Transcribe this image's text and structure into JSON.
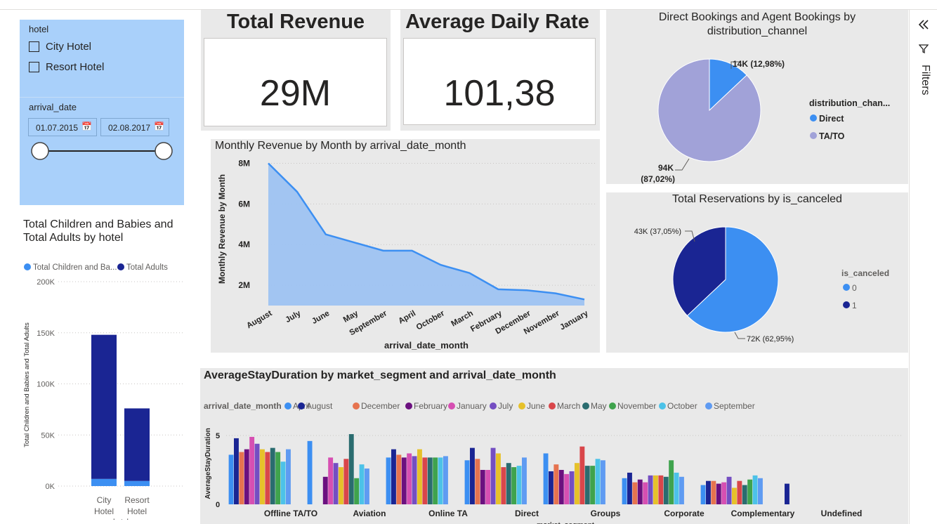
{
  "filters_pane": {
    "label": "Filters",
    "collapse_icon": "double-chevron-left-icon",
    "filter_icon": "funnel-icon"
  },
  "hotel_slicer": {
    "title": "hotel",
    "options": [
      "City Hotel",
      "Resort Hotel"
    ]
  },
  "date_slicer": {
    "title": "arrival_date",
    "start": "01.07.2015",
    "end": "02.08.2017"
  },
  "kpis": [
    {
      "title": "Total Revenue",
      "value": "29M"
    },
    {
      "title": "Average Daily Rate",
      "value": "101,38"
    }
  ],
  "colors": {
    "panel_bg": "#e9e9e9",
    "slicer_bg": "#a9d0fa",
    "light_blue": "#3c8ff2",
    "dark_blue": "#1a2593",
    "lavender": "#a1a2d8"
  },
  "chart_data": [
    {
      "id": "children_adults",
      "type": "bar",
      "stacked": true,
      "title": "Total Children and Babies and Total Adults by hotel",
      "xlabel": "hotel",
      "ylabel": "Total Children and Babies and Total Adults",
      "legend": [
        "Total Children and Ba...",
        "Total Adults"
      ],
      "ytick_labels": [
        "0K",
        "50K",
        "100K",
        "150K",
        "200K"
      ],
      "categories": [
        "City Hotel",
        "Resort Hotel"
      ],
      "category_lines": [
        [
          "City",
          "Hotel"
        ],
        [
          "Resort",
          "Hotel"
        ]
      ],
      "series": [
        {
          "name": "Total Children and Babies",
          "color": "#3c8ff2",
          "values": [
            7000,
            5000
          ]
        },
        {
          "name": "Total Adults",
          "color": "#1a2593",
          "values": [
            141000,
            71000
          ]
        }
      ],
      "ylim": [
        0,
        200000
      ]
    },
    {
      "id": "monthly_revenue",
      "type": "area",
      "title": "Monthly Revenue by Month by arrival_date_month",
      "xlabel": "arrival_date_month",
      "ylabel": "Monthly Revenue by Month",
      "ytick_labels": [
        "2M",
        "4M",
        "6M",
        "8M"
      ],
      "categories": [
        "August",
        "July",
        "June",
        "May",
        "September",
        "April",
        "October",
        "March",
        "February",
        "December",
        "November",
        "January"
      ],
      "values": [
        8000000,
        6600000,
        4500000,
        4100000,
        3700000,
        3700000,
        3000000,
        2600000,
        1800000,
        1750000,
        1600000,
        1300000
      ],
      "ylim": [
        1000000,
        8500000
      ],
      "fill": "#9ec3f2",
      "line": "#3c8ff2"
    },
    {
      "id": "distribution_channel",
      "type": "pie",
      "title": "Direct Bookings and Agent Bookings by distribution_channel",
      "legend_title": "distribution_chan...",
      "slices": [
        {
          "name": "Direct",
          "value": 12.98,
          "label": "14K (12,98%)",
          "color": "#3c8ff2"
        },
        {
          "name": "TA/TO",
          "value": 87.02,
          "label_lines": [
            "94K",
            "(87,02%)"
          ],
          "color": "#a1a2d8"
        }
      ]
    },
    {
      "id": "is_canceled",
      "type": "pie",
      "title": "Total Reservations by is_canceled",
      "legend_title": "is_canceled",
      "slices": [
        {
          "name": "0",
          "value": 62.95,
          "label": "72K (62,95%)",
          "color": "#3c8ff2"
        },
        {
          "name": "1",
          "value": 37.05,
          "label": "43K (37,05%)",
          "color": "#1a2593"
        }
      ]
    },
    {
      "id": "avg_stay",
      "type": "bar",
      "title": "AverageStayDuration by market_segment and arrival_date_month",
      "legend_title": "arrival_date_month",
      "xlabel": "market_segment",
      "ylabel": "AverageStayDuration",
      "ytick_labels": [
        "0",
        "5"
      ],
      "ylim": [
        0,
        5
      ],
      "categories": [
        "Offline TA/TO",
        "Aviation",
        "Online TA",
        "Direct",
        "Groups",
        "Corporate",
        "Complementary",
        "Undefined"
      ],
      "series": [
        {
          "name": "April",
          "color": "#3c8ff2",
          "values": [
            3.6,
            4.6,
            3.4,
            3.2,
            3.7,
            1.9,
            1.4,
            0
          ]
        },
        {
          "name": "August",
          "color": "#1a2593",
          "values": [
            4.8,
            0,
            4.0,
            4.1,
            2.4,
            2.3,
            1.7,
            1.5
          ]
        },
        {
          "name": "December",
          "color": "#e6734f",
          "values": [
            3.8,
            0,
            3.6,
            3.3,
            2.9,
            1.6,
            1.7,
            0
          ]
        },
        {
          "name": "February",
          "color": "#6b107f",
          "values": [
            4.0,
            2.0,
            3.4,
            2.5,
            2.5,
            1.8,
            1.5,
            0
          ]
        },
        {
          "name": "January",
          "color": "#d64fb2",
          "values": [
            4.9,
            3.4,
            3.7,
            2.5,
            2.2,
            1.6,
            1.6,
            0
          ]
        },
        {
          "name": "July",
          "color": "#744ec2",
          "values": [
            4.4,
            3.0,
            3.5,
            4.1,
            2.4,
            2.1,
            2.0,
            0
          ]
        },
        {
          "name": "June",
          "color": "#e6c12a",
          "values": [
            4.0,
            2.7,
            4.0,
            3.7,
            3.0,
            2.1,
            1.2,
            0
          ]
        },
        {
          "name": "March",
          "color": "#d9464a",
          "values": [
            3.8,
            3.3,
            3.4,
            2.7,
            4.2,
            2.1,
            1.7,
            0
          ]
        },
        {
          "name": "May",
          "color": "#2a6c6f",
          "values": [
            4.1,
            5.1,
            3.4,
            3.0,
            2.8,
            2.0,
            1.4,
            0
          ]
        },
        {
          "name": "November",
          "color": "#3fa34d",
          "values": [
            3.8,
            1.9,
            3.4,
            2.7,
            2.8,
            3.2,
            1.8,
            0
          ]
        },
        {
          "name": "October",
          "color": "#4cc2e8",
          "values": [
            3.1,
            2.9,
            3.4,
            2.8,
            3.3,
            2.3,
            2.1,
            0
          ]
        },
        {
          "name": "September",
          "color": "#5f9bf2",
          "values": [
            4.0,
            2.6,
            3.5,
            3.4,
            3.2,
            2.0,
            1.9,
            0
          ]
        }
      ]
    }
  ]
}
